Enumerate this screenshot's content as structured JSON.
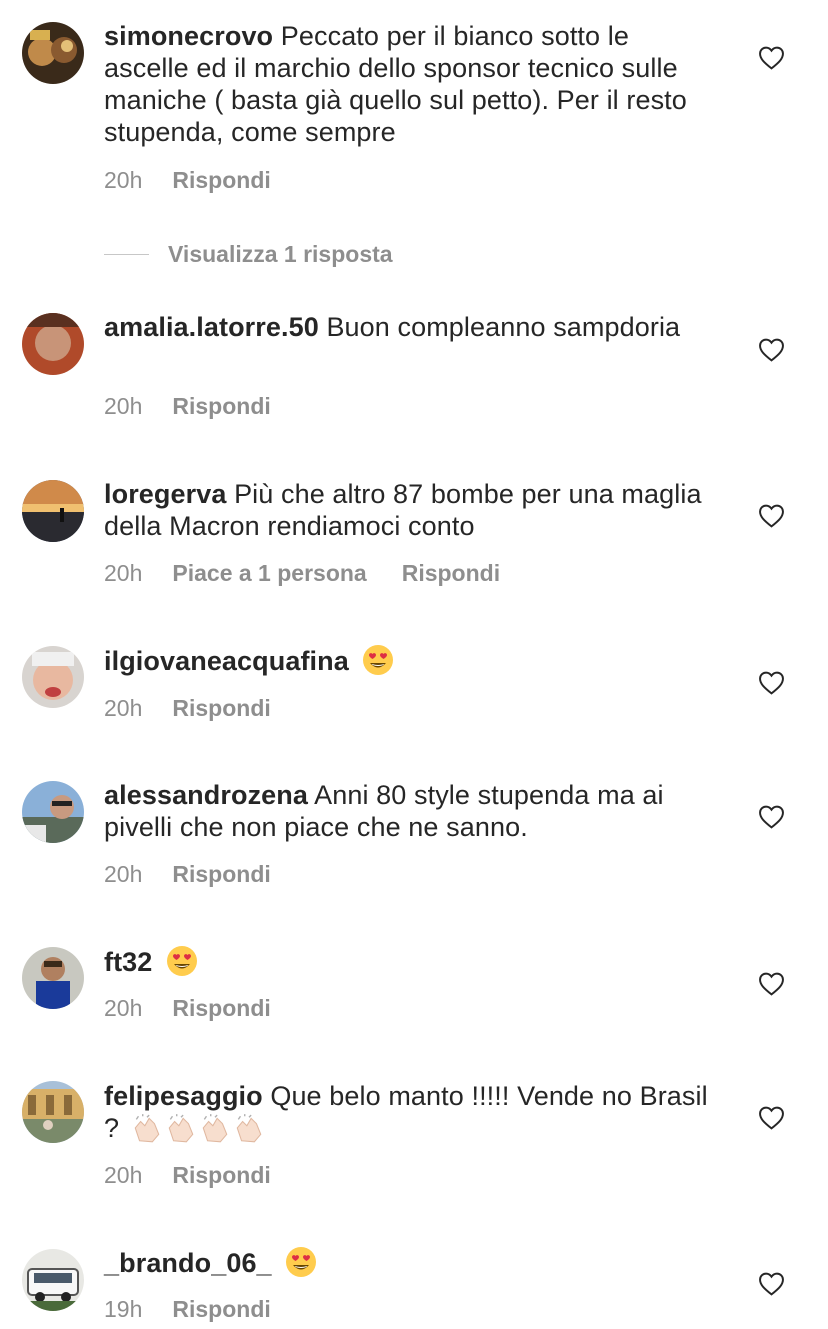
{
  "comments": [
    {
      "username": "simonecrovo",
      "text": "Peccato per il bianco sotto le ascelle ed il marchio dello sponsor tecnico sulle maniche ( basta già quello sul petto). Per il resto stupenda, come sempre",
      "time": "20h",
      "reply": "Rispondi"
    },
    {
      "username": "amalia.latorre.50",
      "text": "Buon compleanno sampdoria",
      "time": "20h",
      "reply": "Rispondi"
    },
    {
      "username": "loregerva",
      "text": "Più che altro 87 bombe per una maglia della Macron rendiamoci conto",
      "time": "20h",
      "likes": "Piace a 1 persona",
      "reply": "Rispondi"
    },
    {
      "username": "ilgiovaneacquafina",
      "text": "",
      "emoji": "heart-eyes-emoji",
      "time": "20h",
      "reply": "Rispondi"
    },
    {
      "username": "alessandrozena",
      "text": "Anni 80 style stupenda ma ai pivelli che non piace che ne sanno.",
      "time": "20h",
      "reply": "Rispondi"
    },
    {
      "username": "ft32",
      "text": "",
      "emoji": "heart-eyes-emoji",
      "time": "20h",
      "reply": "Rispondi"
    },
    {
      "username": "felipesaggio",
      "text": "Que belo manto !!!!! Vende no Brasil ?",
      "emoji": "clapping-hands-emoji",
      "time": "20h",
      "reply": "Rispondi"
    },
    {
      "username": "_brando_06_",
      "text": "",
      "emoji": "heart-eyes-emoji",
      "time": "19h",
      "reply": "Rispondi"
    }
  ],
  "view_replies": "Visualizza 1 risposta",
  "icons": {
    "like": "heart-outline-icon"
  },
  "colors": {
    "text": "#262626",
    "secondary": "#8e8e8e",
    "background": "#ffffff"
  }
}
